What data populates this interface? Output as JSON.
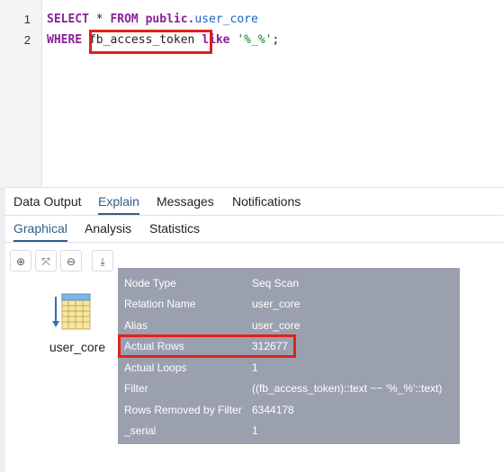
{
  "editor": {
    "line_numbers": [
      "1",
      "2"
    ],
    "line1": {
      "kw1": "SELECT",
      "star": " * ",
      "kw2": "FROM",
      "schema": " public.",
      "table": "user_core"
    },
    "line2": {
      "kw1": "WHERE",
      "space": " ",
      "column": "fb_access_token",
      "space2": " ",
      "kw2": "like",
      "space3": " ",
      "pattern": "'%_%'",
      "end": ";"
    }
  },
  "tabs": [
    "Data Output",
    "Explain",
    "Messages",
    "Notifications"
  ],
  "explain_tabs": [
    "Graphical",
    "Analysis",
    "Statistics"
  ],
  "toolbar": [
    {
      "icon": "zoom-in-icon",
      "glyph": "⊕"
    },
    {
      "icon": "fit-screen-icon",
      "glyph": "⤧"
    },
    {
      "icon": "zoom-out-icon",
      "glyph": "⊖"
    },
    {
      "icon": "download-icon",
      "glyph": "⤓"
    }
  ],
  "node": {
    "label": "user_core"
  },
  "tooltip": {
    "rows": [
      {
        "key": "Node Type",
        "value": "Seq Scan"
      },
      {
        "key": "Relation Name",
        "value": "user_core"
      },
      {
        "key": "Alias",
        "value": "user_core"
      },
      {
        "key": "Actual Rows",
        "value": "312677"
      },
      {
        "key": "Actual Loops",
        "value": "1"
      },
      {
        "key": "Filter",
        "value": "((fb_access_token)::text ~~ '%_%'::text)"
      },
      {
        "key": "Rows Removed by Filter",
        "value": "6344178"
      },
      {
        "key": "_serial",
        "value": "1"
      }
    ]
  },
  "colors": {
    "keyword": "#8a1f9c",
    "identifier": "#1a63c9",
    "string": "#18801c",
    "highlight": "#e0211c",
    "tooltip_bg": "#9aa0ae",
    "active_tab": "#2d5f8e"
  }
}
